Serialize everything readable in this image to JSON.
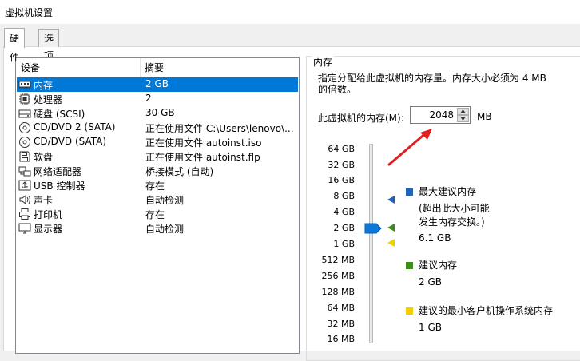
{
  "window": {
    "title": "虚拟机设置"
  },
  "tabs": [
    {
      "label": "硬件",
      "active": true
    },
    {
      "label": "选项",
      "active": false
    }
  ],
  "device_list": {
    "headers": {
      "device": "设备",
      "summary": "摘要"
    },
    "rows": [
      {
        "icon": "memory-icon",
        "name": "内存",
        "summary": "2 GB",
        "selected": true
      },
      {
        "icon": "processor-icon",
        "name": "处理器",
        "summary": "2"
      },
      {
        "icon": "hard-disk-icon",
        "name": "硬盘 (SCSI)",
        "summary": "30 GB"
      },
      {
        "icon": "cd-dvd-icon",
        "name": "CD/DVD 2 (SATA)",
        "summary": "正在使用文件 C:\\Users\\lenovo\\..."
      },
      {
        "icon": "cd-dvd-icon",
        "name": "CD/DVD (SATA)",
        "summary": "正在使用文件 autoinst.iso"
      },
      {
        "icon": "floppy-icon",
        "name": "软盘",
        "summary": "正在使用文件 autoinst.flp"
      },
      {
        "icon": "network-adapter-icon",
        "name": "网络适配器",
        "summary": "桥接模式 (自动)"
      },
      {
        "icon": "usb-controller-icon",
        "name": "USB 控制器",
        "summary": "存在"
      },
      {
        "icon": "sound-card-icon",
        "name": "声卡",
        "summary": "自动检测"
      },
      {
        "icon": "printer-icon",
        "name": "打印机",
        "summary": "存在"
      },
      {
        "icon": "display-icon",
        "name": "显示器",
        "summary": "自动检测"
      }
    ]
  },
  "memory_panel": {
    "group_title": "内存",
    "description": "指定分配给此虚拟机的内存量。内存大小必须为 4 MB 的倍数。",
    "input_label": "此虚拟机的内存(M):",
    "value": "2048",
    "unit": "MB",
    "scale_labels": [
      "64 GB",
      "32 GB",
      "16 GB",
      "8 GB",
      "4 GB",
      "2 GB",
      "1 GB",
      "512 MB",
      "256 MB",
      "128 MB",
      "64 MB",
      "32 MB",
      "16 MB"
    ],
    "legend": {
      "max_recommended": {
        "title": "最大建议内存",
        "note_line1": "(超出此大小可能",
        "note_line2": "发生内存交换。)",
        "value": "6.1 GB",
        "color": "#1e63b5"
      },
      "recommended": {
        "title": "建议内存",
        "value": "2 GB",
        "color": "#3c8c1e"
      },
      "min_recommended": {
        "title": "建议的最小客户机操作系统内存",
        "value": "1 GB",
        "color": "#f3cf00"
      }
    },
    "arrow_color": "#e02020"
  }
}
